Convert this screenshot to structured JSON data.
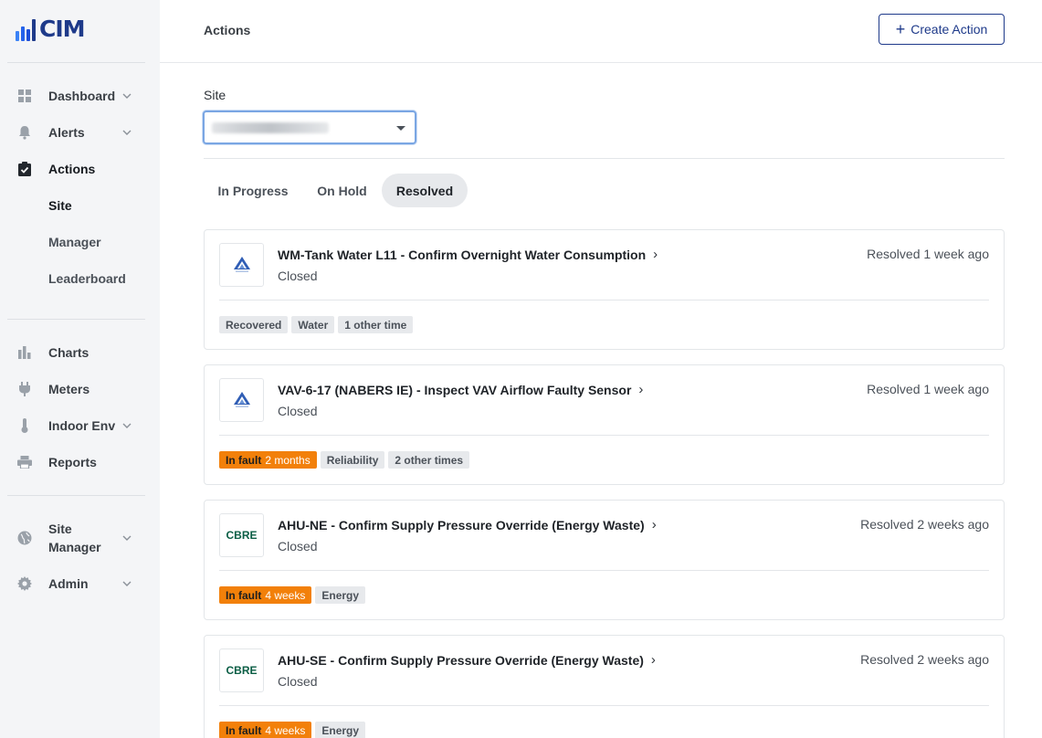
{
  "app": {
    "logo_text": "CIM"
  },
  "sidebar": {
    "items": [
      {
        "label": "Dashboard",
        "icon": "dashboard-grid-icon",
        "has_chevron": true
      },
      {
        "label": "Alerts",
        "icon": "bell-icon",
        "has_chevron": true
      },
      {
        "label": "Actions",
        "icon": "clipboard-check-icon",
        "has_chevron": false,
        "active": true
      },
      {
        "label": "Charts",
        "icon": "bar-chart-icon",
        "has_chevron": false
      },
      {
        "label": "Meters",
        "icon": "plug-icon",
        "has_chevron": false
      },
      {
        "label": "Indoor Env",
        "icon": "thermometer-icon",
        "has_chevron": true
      },
      {
        "label": "Reports",
        "icon": "printer-icon",
        "has_chevron": false
      },
      {
        "label_line1": "Site",
        "label_line2": "Manager",
        "icon": "globe-icon",
        "has_chevron": true
      },
      {
        "label": "Admin",
        "icon": "gear-icon",
        "has_chevron": true
      }
    ],
    "subitems": [
      {
        "label": "Site",
        "active": true
      },
      {
        "label": "Manager",
        "active": false
      },
      {
        "label": "Leaderboard",
        "active": false
      }
    ]
  },
  "header": {
    "title": "Actions",
    "create_button": "Create Action"
  },
  "filters": {
    "site_label": "Site"
  },
  "tabs": [
    {
      "label": "In Progress",
      "active": false
    },
    {
      "label": "On Hold",
      "active": false
    },
    {
      "label": "Resolved",
      "active": true
    }
  ],
  "cards": [
    {
      "logo": "triangle-logo",
      "title": "WM-Tank Water L11 - Confirm Overnight Water Consumption",
      "status": "Closed",
      "time": "Resolved 1 week ago",
      "tags": [
        {
          "label": "Recovered",
          "kind": "plain"
        },
        {
          "label": "Water",
          "kind": "plain"
        },
        {
          "label": "1 other time",
          "kind": "plain"
        }
      ]
    },
    {
      "logo": "triangle-logo",
      "title": "VAV-6-17 (NABERS IE) - Inspect VAV Airflow Faulty Sensor",
      "status": "Closed",
      "time": "Resolved 1 week ago",
      "tags": [
        {
          "label": "In fault",
          "duration": "2 months",
          "kind": "fault"
        },
        {
          "label": "Reliability",
          "kind": "plain"
        },
        {
          "label": "2 other times",
          "kind": "plain"
        }
      ]
    },
    {
      "logo": "CBRE",
      "title": "AHU-NE - Confirm Supply Pressure Override (Energy Waste)",
      "status": "Closed",
      "time": "Resolved 2 weeks ago",
      "tags": [
        {
          "label": "In fault",
          "duration": "4 weeks",
          "kind": "fault"
        },
        {
          "label": "Energy",
          "kind": "plain"
        }
      ]
    },
    {
      "logo": "CBRE",
      "title": "AHU-SE - Confirm Supply Pressure Override (Energy Waste)",
      "status": "Closed",
      "time": "Resolved 2 weeks ago",
      "tags": [
        {
          "label": "In fault",
          "duration": "4 weeks",
          "kind": "fault"
        },
        {
          "label": "Energy",
          "kind": "plain"
        }
      ]
    }
  ],
  "colors": {
    "brand": "#1e3a8a",
    "fault": "#f2800a",
    "tag_bg": "#e7e9ec",
    "sidebar_bg": "#f4f5f7"
  }
}
